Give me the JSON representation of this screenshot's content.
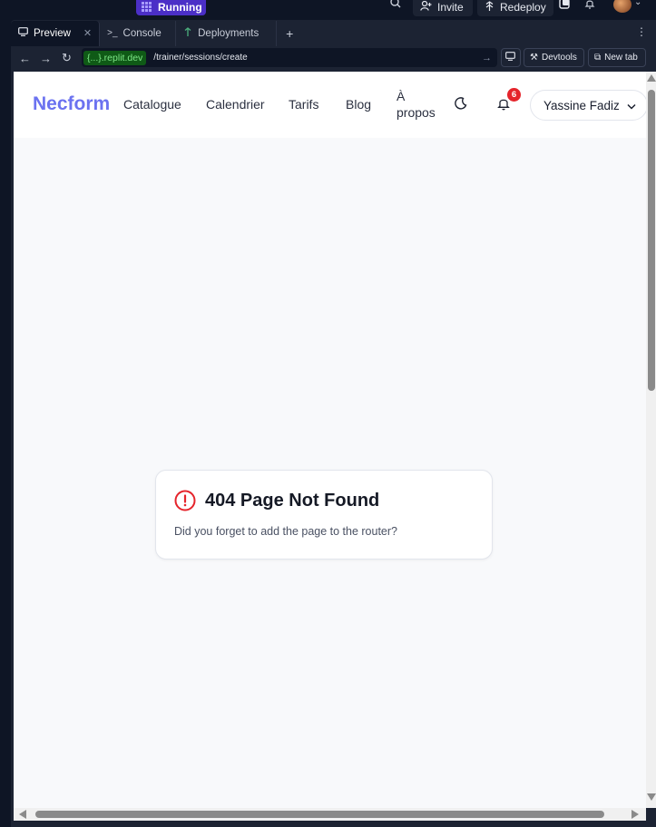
{
  "topbar": {
    "run_label": "Running",
    "invite_label": "Invite",
    "redeploy_label": "Redeploy"
  },
  "tabs": [
    {
      "label": "Preview",
      "active": true
    },
    {
      "label": "Console",
      "active": false
    },
    {
      "label": "Deployments",
      "active": false
    }
  ],
  "urlbar": {
    "host": "{...}.replit.dev",
    "path": "/trainer/sessions/create",
    "devtools_label": "Devtools",
    "newtab_label": "New tab"
  },
  "site": {
    "logo": "Necform",
    "nav": [
      "Catalogue",
      "Calendrier",
      "Tarifs",
      "Blog",
      "À",
      "propos"
    ],
    "notification_count": "6",
    "user_name": "Yassine Fadiz"
  },
  "error_card": {
    "title": "404 Page Not Found",
    "message": "Did you forget to add the page to the router?"
  },
  "colors": {
    "brand": "#6b72f0",
    "run_button": "#4b2fc7",
    "error": "#e5242b",
    "host_green": "#7ee787"
  }
}
